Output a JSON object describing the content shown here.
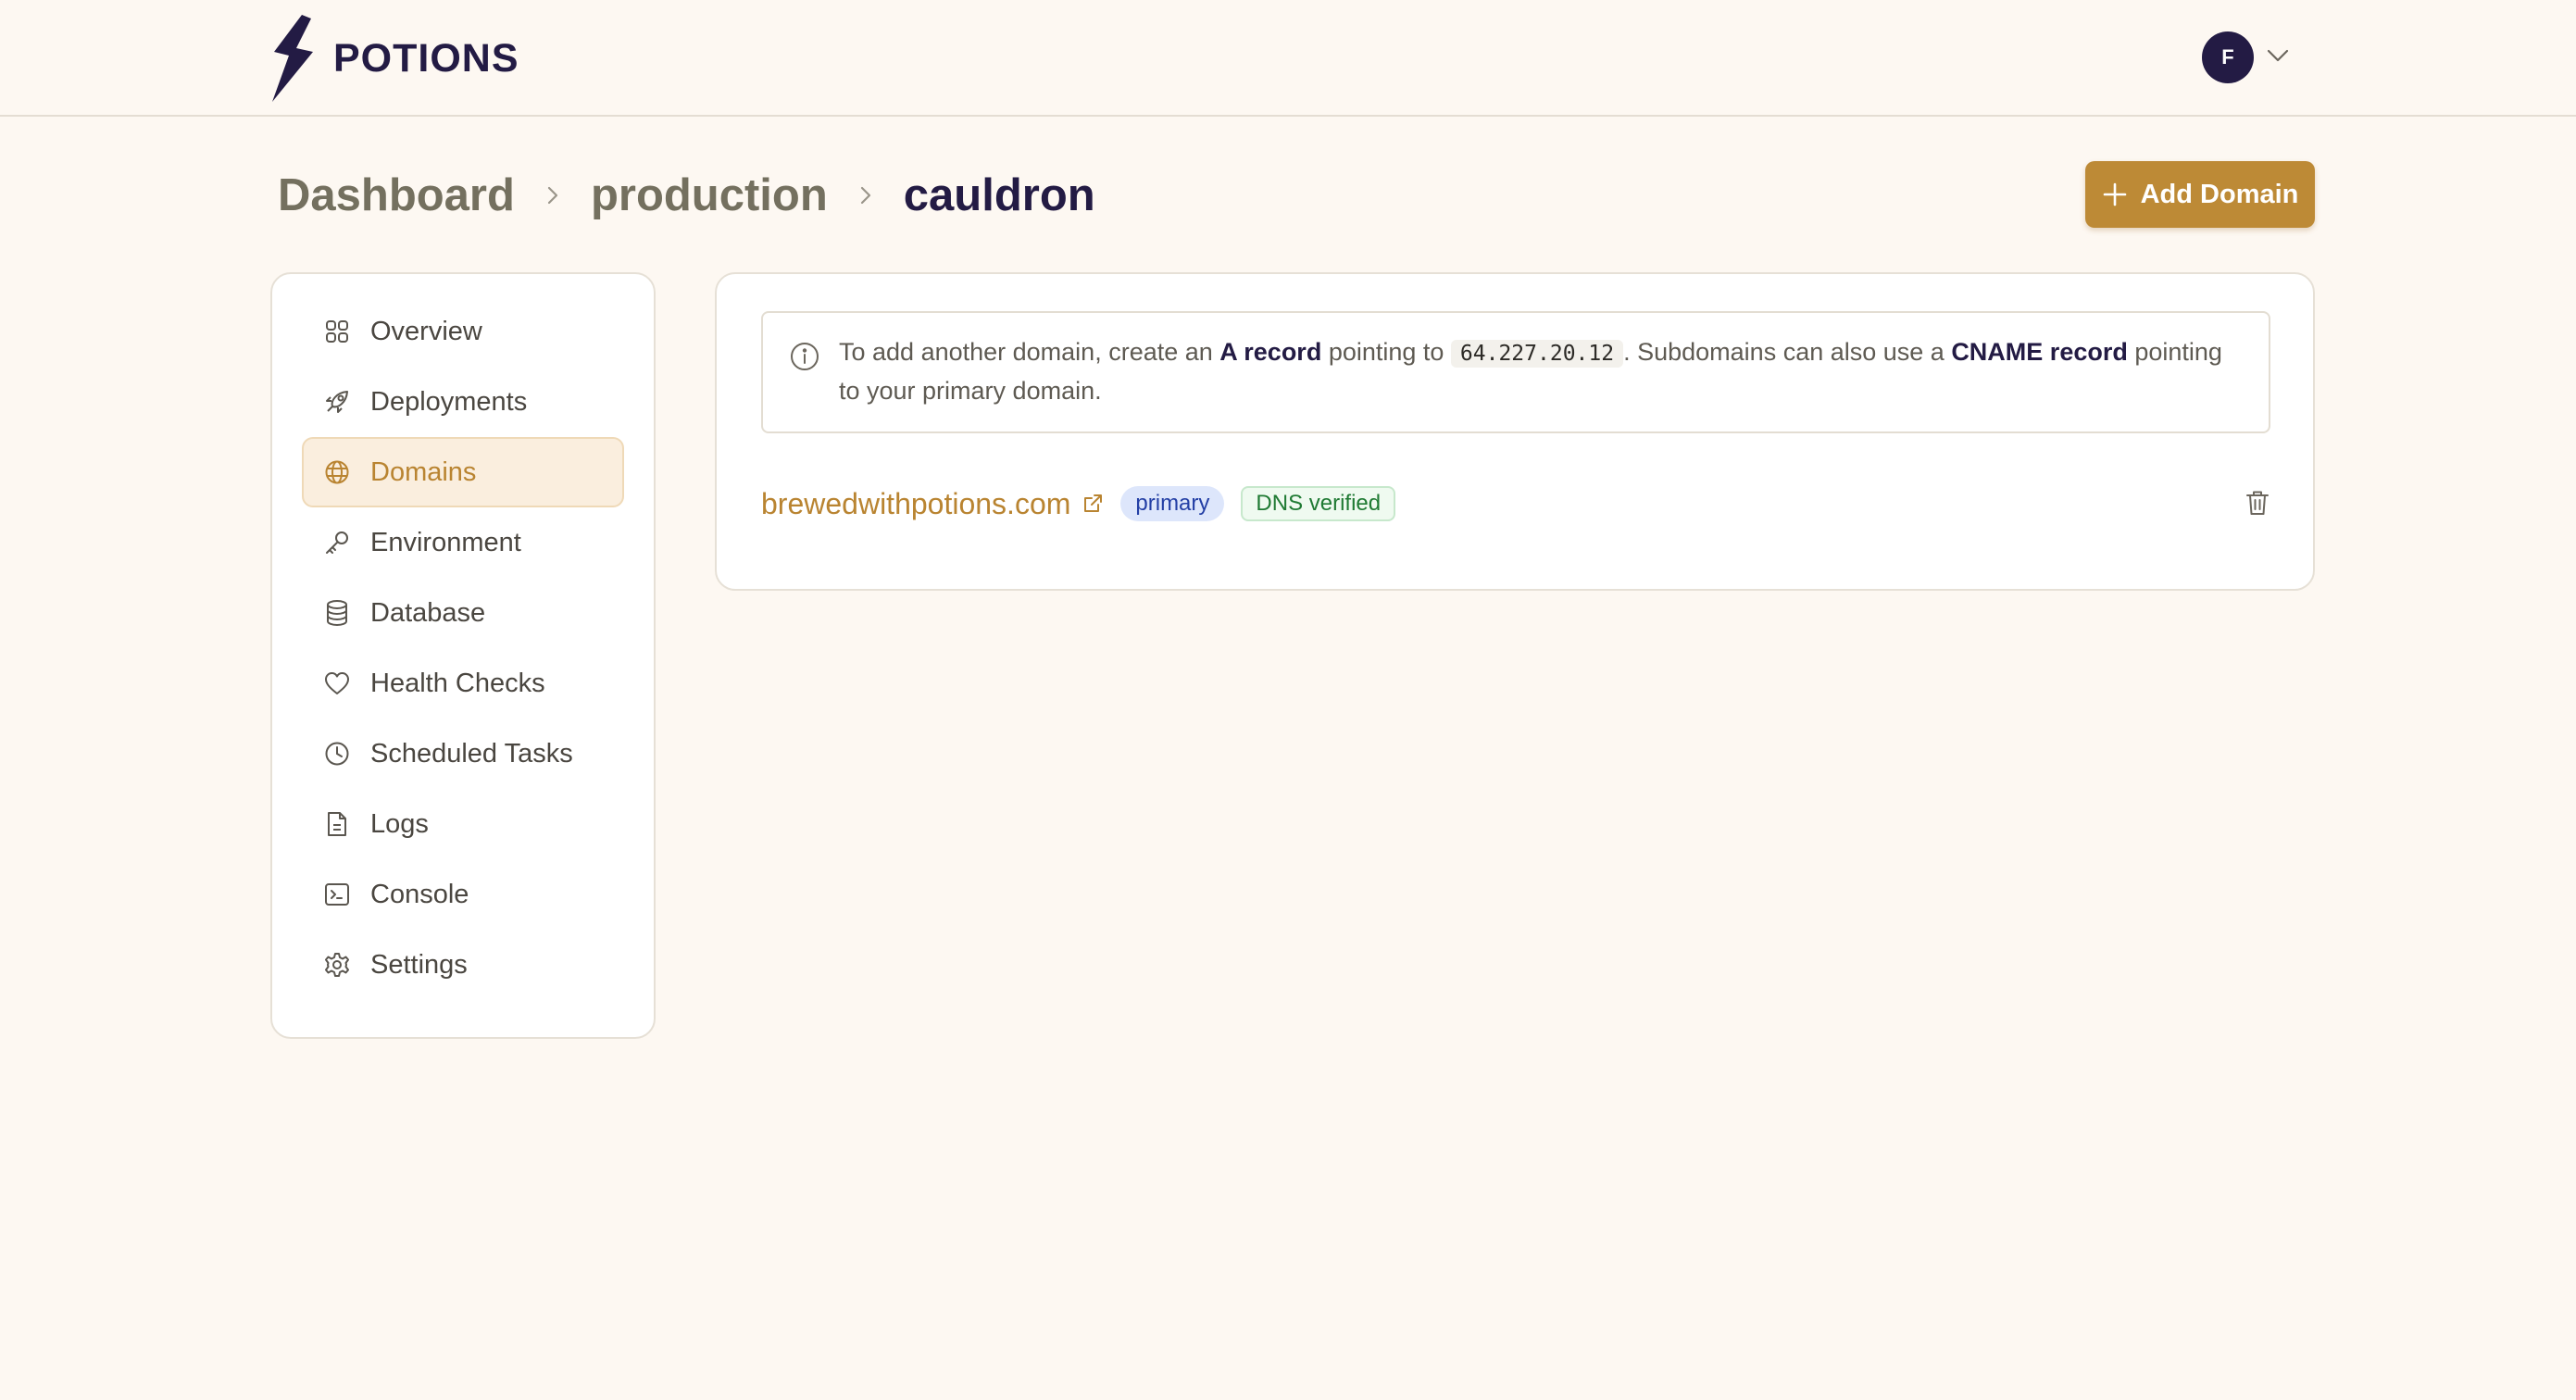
{
  "app": {
    "name": "POTIONS",
    "brand_color": "#231b44",
    "accent_color": "#bd8a36"
  },
  "user": {
    "initial": "F",
    "menu_icon": "chevron-down-icon"
  },
  "breadcrumb": {
    "items": [
      "Dashboard",
      "production",
      "cauldron"
    ],
    "separator_icon": "chevron-right-icon"
  },
  "actions": {
    "add_domain_label": "Add Domain",
    "add_domain_icon": "plus-icon"
  },
  "sidebar": {
    "items": [
      {
        "label": "Overview",
        "icon": "grid-icon",
        "active": false
      },
      {
        "label": "Deployments",
        "icon": "rocket-icon",
        "active": false
      },
      {
        "label": "Domains",
        "icon": "globe-icon",
        "active": true
      },
      {
        "label": "Environment",
        "icon": "key-icon",
        "active": false
      },
      {
        "label": "Database",
        "icon": "database-icon",
        "active": false
      },
      {
        "label": "Health Checks",
        "icon": "heart-icon",
        "active": false
      },
      {
        "label": "Scheduled Tasks",
        "icon": "clock-icon",
        "active": false
      },
      {
        "label": "Logs",
        "icon": "file-icon",
        "active": false
      },
      {
        "label": "Console",
        "icon": "terminal-icon",
        "active": false
      },
      {
        "label": "Settings",
        "icon": "gear-icon",
        "active": false
      }
    ]
  },
  "info": {
    "icon": "info-icon",
    "text_1": "To add another domain, create an ",
    "bold_1": "A record",
    "text_2": " pointing to ",
    "ip": "64.227.20.12",
    "text_3": ". Subdomains can also use a ",
    "bold_2": "CNAME record",
    "text_4": " pointing to your primary domain."
  },
  "domains": [
    {
      "name": "brewedwithpotions.com",
      "badge_primary": "primary",
      "badge_status": "DNS verified",
      "delete_icon": "trash-icon",
      "external_icon": "external-link-icon"
    }
  ]
}
